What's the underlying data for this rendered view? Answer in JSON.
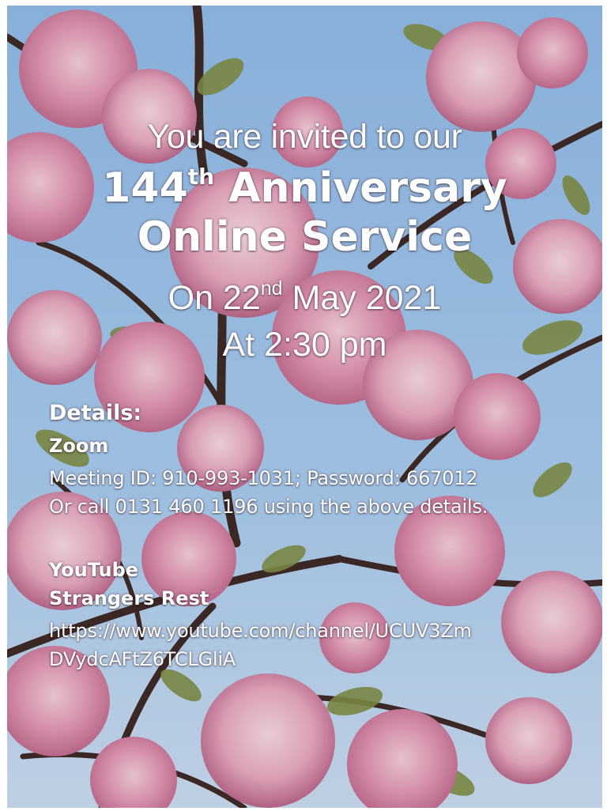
{
  "invitation": {
    "line1": "You are invited to our",
    "title_number": "144",
    "title_ordinal": "th",
    "title_word": "Anniversary",
    "title_line2": "Online Service",
    "date_prefix": "On 22",
    "date_ordinal": "nd",
    "date_suffix": "May 2021",
    "time": "At 2:30 pm"
  },
  "details": {
    "heading": "Details:",
    "zoom": {
      "label": "Zoom",
      "meeting": "Meeting ID: 910-993-1031; Password: 667012",
      "call": "Or call 0131 460 1196 using the above details."
    },
    "youtube": {
      "label": "YouTube",
      "channel": "Strangers Rest",
      "url_line1": "https://www.youtube.com/channel/UCUV3Zm",
      "url_line2": "DVydcAFtZ6TCLGliA"
    }
  },
  "colors": {
    "sky": "#9ac4ec",
    "blossom": "#e7a2bd",
    "leaf": "#7d8f44",
    "branch": "#3b2a24",
    "text": "#ffffff"
  }
}
